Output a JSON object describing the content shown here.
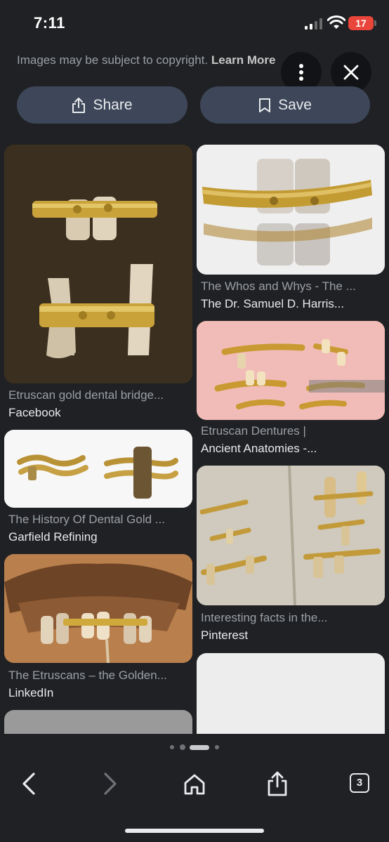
{
  "status_bar": {
    "time": "7:11",
    "battery_level": "17"
  },
  "header": {
    "copyright_text": "Images may be subject to copyright.",
    "learn_more": "Learn More",
    "share_label": "Share",
    "save_label": "Save",
    "more_icon": "more-vertical-icon",
    "close_icon": "close-icon"
  },
  "results": [
    {
      "title": "Etruscan gold dental bridge...",
      "source": "Facebook"
    },
    {
      "title": "The Whos and Whys - The ...",
      "source": "The Dr. Samuel D. Harris..."
    },
    {
      "title": "Etruscan Dentures |",
      "source": "Ancient Anatomies -..."
    },
    {
      "title": "The History Of Dental Gold ...",
      "source": "Garfield Refining"
    },
    {
      "title": "Interesting facts in the...",
      "source": "Pinterest"
    },
    {
      "title": "The Etruscans – the Golden...",
      "source": "LinkedIn"
    }
  ],
  "bottom_nav": {
    "tab_count": "3"
  },
  "colors": {
    "background": "#202124",
    "pill": "#3d4759",
    "battery": "#e9453a"
  }
}
